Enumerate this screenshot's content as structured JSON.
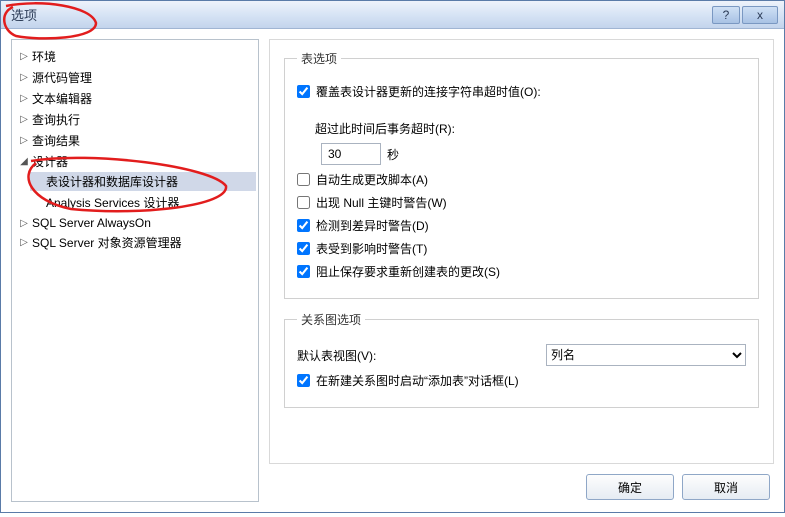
{
  "window": {
    "title": "选项"
  },
  "titlebar": {
    "help_label": "?",
    "close_label": "x"
  },
  "tree": {
    "items": [
      {
        "label": "环境"
      },
      {
        "label": "源代码管理"
      },
      {
        "label": "文本编辑器"
      },
      {
        "label": "查询执行"
      },
      {
        "label": "查询结果"
      }
    ],
    "designer": {
      "label": "设计器",
      "children": [
        {
          "label": "表设计器和数据库设计器"
        },
        {
          "label": "Analysis Services 设计器"
        }
      ]
    },
    "tail": [
      {
        "label": "SQL Server AlwaysOn"
      },
      {
        "label": "SQL Server 对象资源管理器"
      }
    ]
  },
  "table_options": {
    "legend": "表选项",
    "override_conn_timeout": {
      "label": "覆盖表设计器更新的连接字符串超时值(O):",
      "checked": true
    },
    "timeout": {
      "label_prefix": "超过此时间后事务超时(R):",
      "value": "30",
      "unit": "秒"
    },
    "auto_gen_script": {
      "label": "自动生成更改脚本(A)",
      "checked": false
    },
    "null_pk_warning": {
      "label": "出现 Null 主键时警告(W)",
      "checked": false
    },
    "diff_warning": {
      "label": "检测到差异时警告(D)",
      "checked": true
    },
    "affected_warning": {
      "label": "表受到影响时警告(T)",
      "checked": true
    },
    "prevent_recreate": {
      "label": "阻止保存要求重新创建表的更改(S)",
      "checked": true
    }
  },
  "diagram_options": {
    "legend": "关系图选项",
    "default_view": {
      "label": "默认表视图(V):",
      "value": "列名"
    },
    "launch_add_table": {
      "label": "在新建关系图时启动“添加表”对话框(L)",
      "checked": true
    }
  },
  "footer": {
    "ok": "确定",
    "cancel": "取消"
  }
}
